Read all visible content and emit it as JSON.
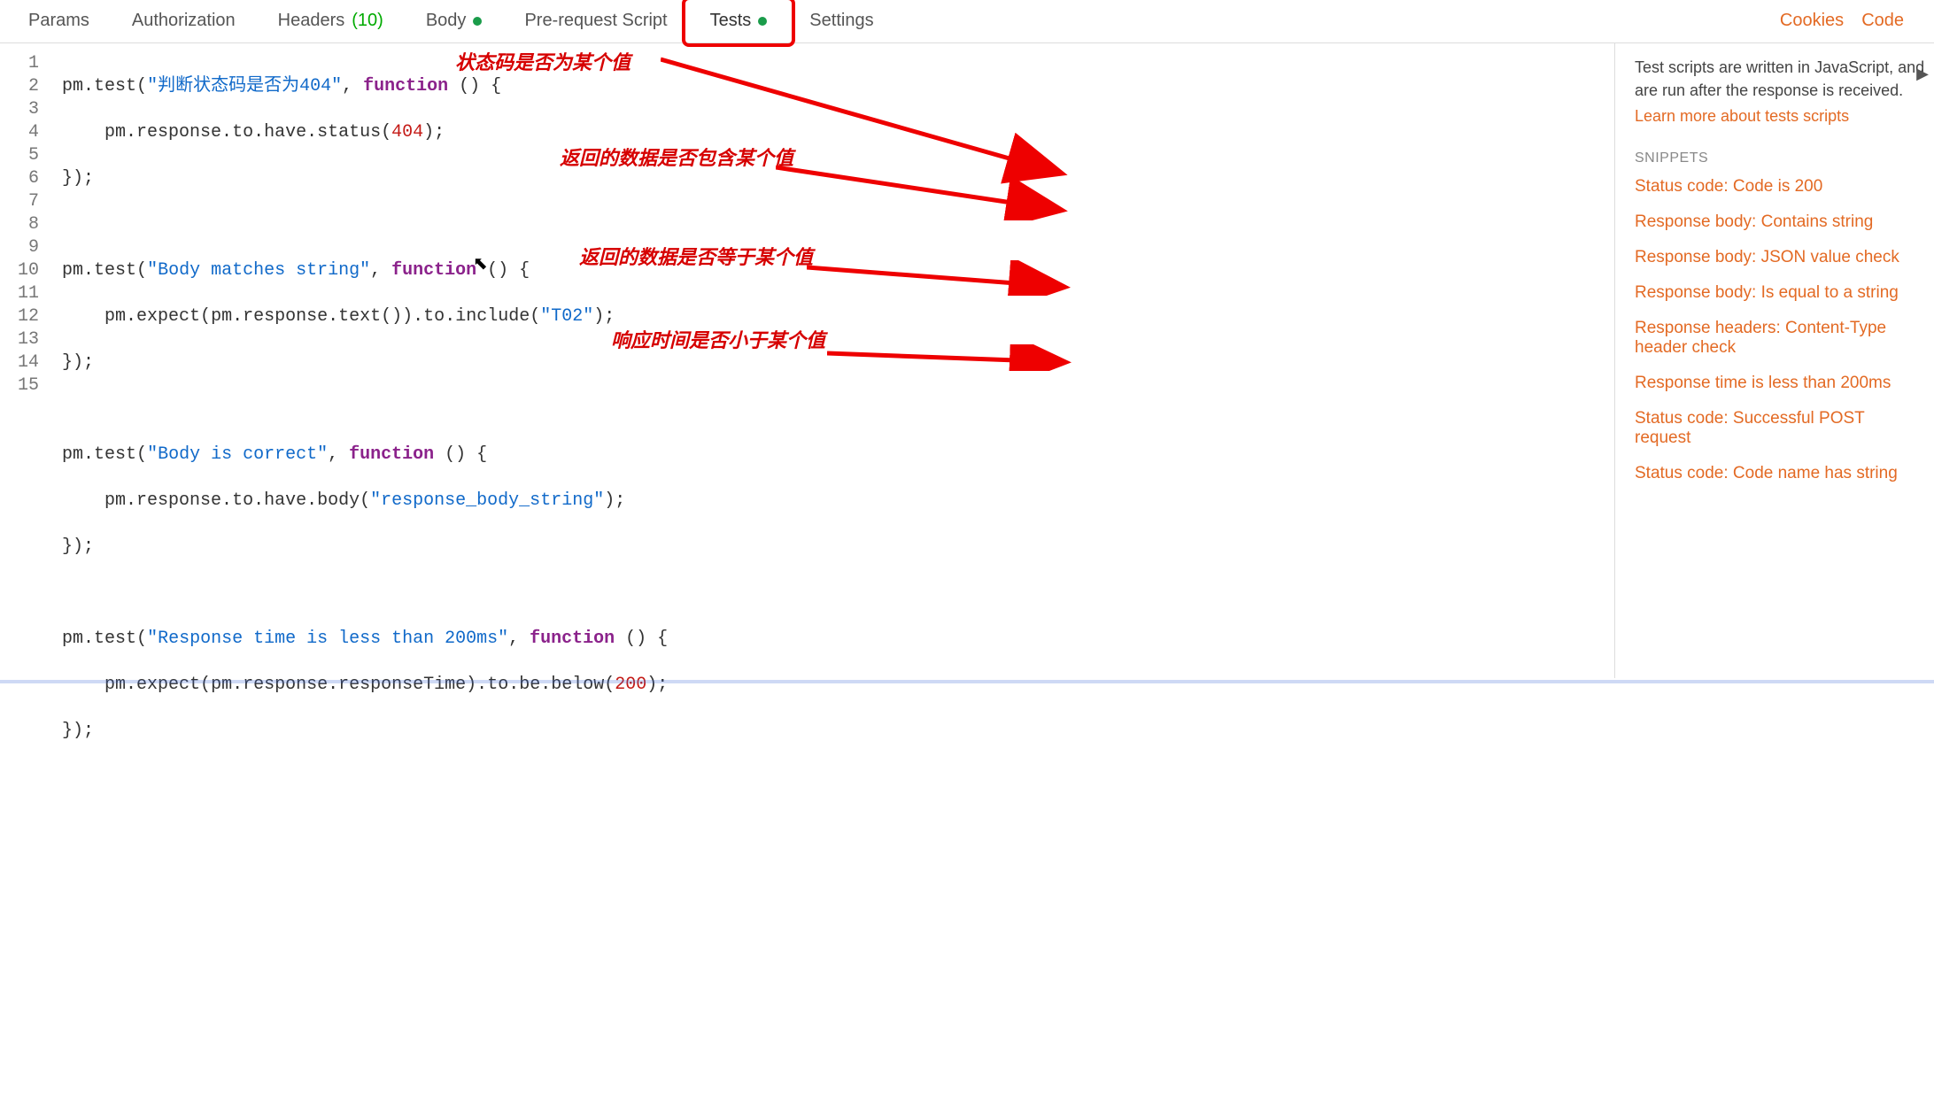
{
  "tabs": {
    "params": "Params",
    "authorization": "Authorization",
    "headers": "Headers",
    "headers_count": "(10)",
    "body": "Body",
    "prerequest": "Pre-request Script",
    "tests": "Tests",
    "settings": "Settings"
  },
  "topRight": {
    "cookies": "Cookies",
    "code": "Code"
  },
  "gutter": [
    "1",
    "2",
    "3",
    "4",
    "5",
    "6",
    "7",
    "8",
    "9",
    "10",
    "11",
    "12",
    "13",
    "14",
    "15"
  ],
  "code": {
    "l1_a": "pm",
    "l1_b": ".",
    "l1_c": "test",
    "l1_d": "(",
    "l1_e": "\"判断状态码是否为404\"",
    "l1_f": ", ",
    "l1_g": "function",
    "l1_h": " () {",
    "l2_a": "    pm",
    "l2_b": ".",
    "l2_c": "response",
    "l2_d": ".",
    "l2_e": "to",
    "l2_f": ".",
    "l2_g": "have",
    "l2_h": ".",
    "l2_i": "status",
    "l2_j": "(",
    "l2_k": "404",
    "l2_l": ");",
    "l3": "});",
    "l5_a": "pm",
    "l5_b": ".",
    "l5_c": "test",
    "l5_d": "(",
    "l5_e": "\"Body matches string\"",
    "l5_f": ", ",
    "l5_g": "function",
    "l5_h": " () {",
    "l6_a": "    pm",
    "l6_b": ".",
    "l6_c": "expect",
    "l6_d": "(",
    "l6_e": "pm",
    "l6_f": ".",
    "l6_g": "response",
    "l6_h": ".",
    "l6_i": "text",
    "l6_j": "())",
    "l6_k": ".",
    "l6_l": "to",
    "l6_m": ".",
    "l6_n": "include",
    "l6_o": "(",
    "l6_p": "\"T02\"",
    "l6_q": ");",
    "l7": "});",
    "l9_a": "pm",
    "l9_b": ".",
    "l9_c": "test",
    "l9_d": "(",
    "l9_e": "\"Body is correct\"",
    "l9_f": ", ",
    "l9_g": "function",
    "l9_h": " () {",
    "l10_a": "    pm",
    "l10_b": ".",
    "l10_c": "response",
    "l10_d": ".",
    "l10_e": "to",
    "l10_f": ".",
    "l10_g": "have",
    "l10_h": ".",
    "l10_i": "body",
    "l10_j": "(",
    "l10_k": "\"response_body_string\"",
    "l10_l": ");",
    "l11": "});",
    "l13_a": "pm",
    "l13_b": ".",
    "l13_c": "test",
    "l13_d": "(",
    "l13_e": "\"Response time is less than 200ms\"",
    "l13_f": ", ",
    "l13_g": "function",
    "l13_h": " () {",
    "l14_a": "    pm",
    "l14_b": ".",
    "l14_c": "expect",
    "l14_d": "(",
    "l14_e": "pm",
    "l14_f": ".",
    "l14_g": "response",
    "l14_h": ".",
    "l14_i": "responseTime",
    "l14_j": ")",
    "l14_k": ".",
    "l14_l": "to",
    "l14_m": ".",
    "l14_n": "be",
    "l14_o": ".",
    "l14_p": "below",
    "l14_q": "(",
    "l14_r": "200",
    "l14_s": ");",
    "l15": "});"
  },
  "annotations": {
    "a1": "状态码是否为某个值",
    "a2": "返回的数据是否包含某个值",
    "a3": "返回的数据是否等于某个值",
    "a4": "响应时间是否小于某个值"
  },
  "rightPanel": {
    "help": "Test scripts are written in JavaScript, and are run after the response is received.",
    "learnMore": "Learn more about tests scripts",
    "snippetsHeader": "SNIPPETS",
    "snippets": [
      "Status code: Code is 200",
      "Response body: Contains string",
      "Response body: JSON value check",
      "Response body: Is equal to a string",
      "Response headers: Content-Type header check",
      "Response time is less than 200ms",
      "Status code: Successful POST request",
      "Status code: Code name has string"
    ]
  }
}
